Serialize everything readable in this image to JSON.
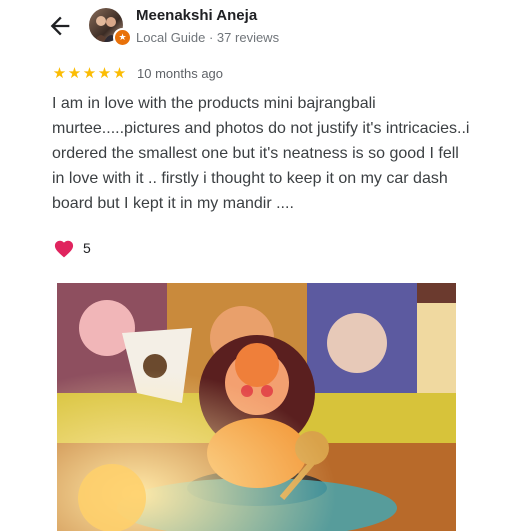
{
  "header": {
    "author_name": "Meenakshi Aneja",
    "author_subtitle": "Local Guide · 37 reviews"
  },
  "review": {
    "rating": 5,
    "stars": [
      "★",
      "★",
      "★",
      "★",
      "★"
    ],
    "date": "10 months ago",
    "text": "I am in love with the products mini bajrangbali murtee.....pictures and photos do not justify it's intricacies..i ordered the smallest one but it's neatness is so good I fell in love with it .. firstly i thought to keep it on my car dash board but I kept it in my mandir ....",
    "like_count": "5"
  },
  "icons": {
    "back": "arrow-back-icon",
    "badge": "local-guide-badge-icon",
    "like": "heart-icon"
  },
  "colors": {
    "star": "#fbbc04",
    "heart": "#e0245e",
    "badge": "#e8710a"
  }
}
